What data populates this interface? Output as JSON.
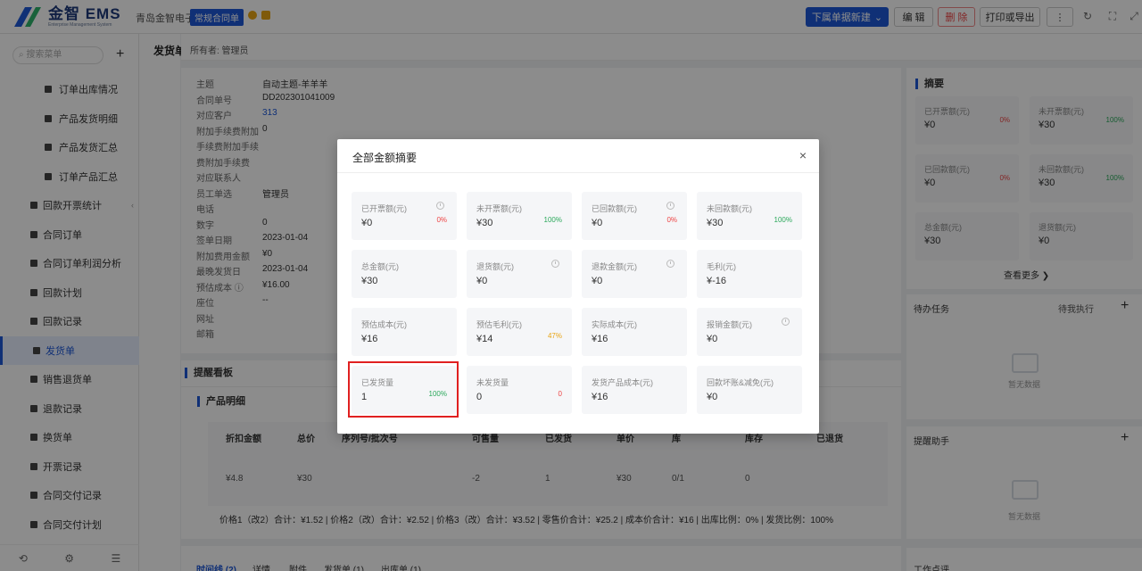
{
  "topbar": {
    "logo_name": "金智 EMS",
    "logo_sub": "Enterprise Management System",
    "company": "青岛金智电子",
    "doc_tag": "常规合同单",
    "new_button": "下属单据新建",
    "edit_button": "编 辑",
    "delete_button": "删 除",
    "print_button": "打印或导出",
    "more_button": "⋮"
  },
  "sidebar": {
    "search_placeholder": "搜索菜单",
    "items": [
      {
        "label": "订单出库情况",
        "sub": true
      },
      {
        "label": "产品发货明细",
        "sub": true
      },
      {
        "label": "产品发货汇总",
        "sub": true
      },
      {
        "label": "订单产品汇总",
        "sub": true
      },
      {
        "label": "回款开票统计",
        "sub": false
      },
      {
        "label": "合同订单",
        "sub": false
      },
      {
        "label": "合同订单利润分析",
        "sub": false
      },
      {
        "label": "回款计划",
        "sub": false
      },
      {
        "label": "回款记录",
        "sub": false
      },
      {
        "label": "发货单",
        "sub": false
      },
      {
        "label": "销售退货单",
        "sub": false
      },
      {
        "label": "退款记录",
        "sub": false
      },
      {
        "label": "换货单",
        "sub": false
      },
      {
        "label": "开票记录",
        "sub": false
      },
      {
        "label": "合同交付记录",
        "sub": false
      },
      {
        "label": "合同交付计划",
        "sub": false
      }
    ]
  },
  "page": {
    "strip_title": "发货单",
    "owner": "所有者: 管理员"
  },
  "info": [
    {
      "k": "主题",
      "v": "自动主题-羊羊羊"
    },
    {
      "k": "合同单号",
      "v": "DD202301041009"
    },
    {
      "k": "对应客户",
      "v": "313"
    },
    {
      "k": "附加手续费附加",
      "v": "0"
    },
    {
      "k": "手续费附加手续",
      "v": ""
    },
    {
      "k": "费附加手续费",
      "v": ""
    },
    {
      "k": "对应联系人",
      "v": ""
    },
    {
      "k": "员工单选",
      "v": "管理员"
    },
    {
      "k": "电话",
      "v": ""
    },
    {
      "k": "数字",
      "v": "0"
    },
    {
      "k": "签单日期",
      "v": "2023-01-04"
    },
    {
      "k": "附加费用金额",
      "v": "¥0"
    },
    {
      "k": "最晚发货日",
      "v": "2023-01-04"
    },
    {
      "k": "预估成本 ⓘ",
      "v": "¥16.00"
    },
    {
      "k": "座位",
      "v": "--"
    },
    {
      "k": "网址",
      "v": ""
    },
    {
      "k": "邮箱",
      "v": ""
    }
  ],
  "reminder": {
    "title": "提醒看板"
  },
  "product": {
    "title": "产品明细",
    "headers": [
      "折扣金额",
      "总价",
      "序列号/批次号",
      "可售量",
      "已发货",
      "单价",
      "库",
      "库存",
      "已退货"
    ],
    "row": [
      "¥4.8",
      "¥30",
      "",
      "-2",
      "1",
      "¥30",
      "0/1",
      "0",
      ""
    ],
    "summary": "价格1（改2）合计：¥1.52 |  价格2（改）合计：¥2.52 |  价格3（改）合计：¥3.52 |  零售价合计：¥25.2 |  成本价合计：¥16 |  出库比例：0% |  发货比例：100%"
  },
  "tabs": [
    "时间线 (2)",
    "详情",
    "附件",
    "发货单 (1)",
    "出库单 (1)"
  ],
  "right": {
    "summary_title": "摘要",
    "cards": [
      {
        "label": "已开票额(元)",
        "value": "¥0",
        "pct": "0%",
        "color": "#e44"
      },
      {
        "label": "未开票额(元)",
        "value": "¥30",
        "pct": "100%",
        "color": "#2aa85a"
      },
      {
        "label": "已回款额(元)",
        "value": "¥0",
        "pct": "0%",
        "color": "#e44"
      },
      {
        "label": "未回款额(元)",
        "value": "¥30",
        "pct": "100%",
        "color": "#2aa85a"
      },
      {
        "label": "总金额(元)",
        "value": "¥30",
        "pct": "",
        "color": ""
      },
      {
        "label": "退货额(元)",
        "value": "¥0",
        "pct": "",
        "color": ""
      }
    ],
    "see_more": "查看更多 ❯",
    "todo_title": "待办任务",
    "todo_filter": "待我执行",
    "empty": "暂无数据",
    "helper_title": "提醒助手",
    "work_title": "工作点评"
  },
  "modal": {
    "title": "全部金额摘要",
    "close": "×",
    "cards": [
      {
        "label": "已开票额(元)",
        "value": "¥0",
        "pct": "0%",
        "pct_color": "#e44",
        "clock": true
      },
      {
        "label": "未开票额(元)",
        "value": "¥30",
        "pct": "100%",
        "pct_color": "#2aa85a",
        "clock": false
      },
      {
        "label": "已回款额(元)",
        "value": "¥0",
        "pct": "0%",
        "pct_color": "#e44",
        "clock": true
      },
      {
        "label": "未回款额(元)",
        "value": "¥30",
        "pct": "100%",
        "pct_color": "#2aa85a",
        "clock": false
      },
      {
        "label": "总金额(元)",
        "value": "¥30",
        "pct": "",
        "pct_color": "",
        "clock": false
      },
      {
        "label": "退货额(元)",
        "value": "¥0",
        "pct": "",
        "pct_color": "",
        "clock": true
      },
      {
        "label": "退款金额(元)",
        "value": "¥0",
        "pct": "",
        "pct_color": "",
        "clock": true
      },
      {
        "label": "毛利(元)",
        "value": "¥-16",
        "pct": "",
        "pct_color": "",
        "clock": false
      },
      {
        "label": "预估成本(元)",
        "value": "¥16",
        "pct": "",
        "pct_color": "",
        "clock": false
      },
      {
        "label": "预估毛利(元)",
        "value": "¥14",
        "pct": "47%",
        "pct_color": "#e8a413",
        "clock": false
      },
      {
        "label": "实际成本(元)",
        "value": "¥16",
        "pct": "",
        "pct_color": "",
        "clock": false
      },
      {
        "label": "报销金额(元)",
        "value": "¥0",
        "pct": "",
        "pct_color": "",
        "clock": true
      },
      {
        "label": "已发货量",
        "value": "1",
        "pct": "100%",
        "pct_color": "#2aa85a",
        "clock": false
      },
      {
        "label": "未发货量",
        "value": "0",
        "pct": "0",
        "pct_color": "#e44",
        "clock": false
      },
      {
        "label": "发货产品成本(元)",
        "value": "¥16",
        "pct": "",
        "pct_color": "",
        "clock": false
      },
      {
        "label": "回款坏账&减免(元)",
        "value": "¥0",
        "pct": "",
        "pct_color": "",
        "clock": false
      }
    ]
  }
}
